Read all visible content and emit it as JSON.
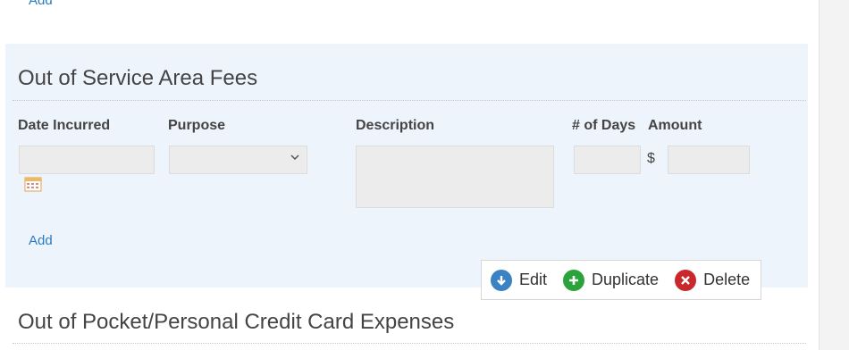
{
  "top_add_label": "Add",
  "section": {
    "title": "Out of Service Area Fees",
    "columns": {
      "date_incurred": "Date Incurred",
      "purpose": "Purpose",
      "description": "Description",
      "days": "# of Days",
      "amount": "Amount"
    },
    "fields": {
      "date_value": "",
      "purpose_value": "",
      "description_value": "",
      "days_value": "",
      "amount_value": ""
    },
    "currency_symbol": "$",
    "add_label": "Add"
  },
  "toolbar": {
    "edit_label": "Edit",
    "duplicate_label": "Duplicate",
    "delete_label": "Delete"
  },
  "next_section_title": "Out of Pocket/Personal Credit Card Expenses",
  "colors": {
    "panel_bg": "#eef4fc",
    "link": "#2a7bbf",
    "edit": "#3b82c4",
    "duplicate": "#2aa43a",
    "delete": "#c8282c"
  }
}
